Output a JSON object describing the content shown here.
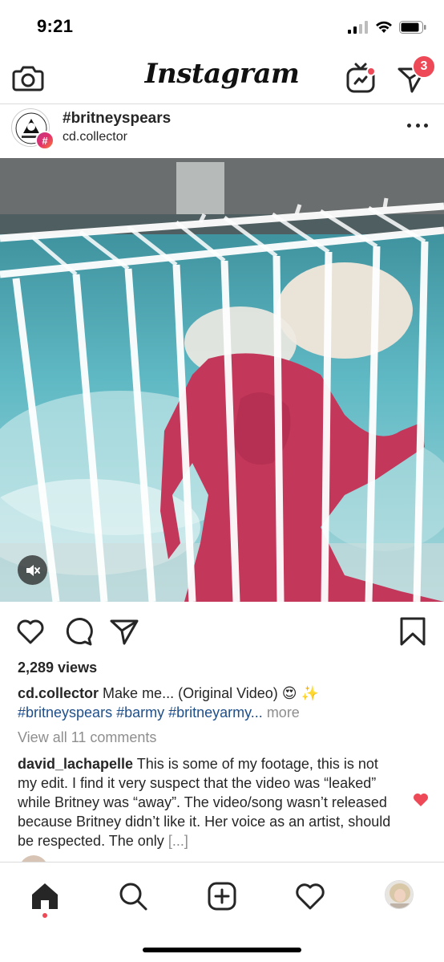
{
  "status_bar": {
    "time": "9:21"
  },
  "nav": {
    "logo": "Instagram",
    "direct_badge_count": "3",
    "icons": [
      "camera-icon",
      "igtv-icon",
      "direct-message-icon"
    ]
  },
  "post": {
    "title": "#britneyspears",
    "subtitle": "cd.collector",
    "hashtag_badge": "#",
    "media_type": "video",
    "muted": true
  },
  "actions": {
    "icons": [
      "like-heart-icon",
      "comment-icon",
      "share-icon",
      "bookmark-icon"
    ]
  },
  "stats": {
    "views": "2,289 views"
  },
  "caption": {
    "username": "cd.collector",
    "text": "Make me... (Original Video) 😍 ✨",
    "hashtags": "#britneyspears #barmy #britneyarmy...",
    "more_label": "more"
  },
  "comments": {
    "view_all_label": "View all 11 comments",
    "top_comment": {
      "username": "david_lachapelle",
      "text": "This is some of my footage, this is not my edit. I find it very suspect that the video was “leaked” while Britney was “away”. The video/song wasn’t released because Britney didn’t like it. Her voice as an artist, should be respected. The only",
      "truncation": "[...]",
      "liked": true
    }
  },
  "tab_bar": {
    "items": [
      "home-icon",
      "search-icon",
      "add-post-icon",
      "activity-heart-icon",
      "profile-avatar"
    ],
    "active": "home-icon"
  },
  "colors": {
    "badge_red": "#ed4956",
    "hashtag_blue": "#1f4f8a",
    "muted_gray": "#8e8e8e",
    "text": "#262626"
  }
}
